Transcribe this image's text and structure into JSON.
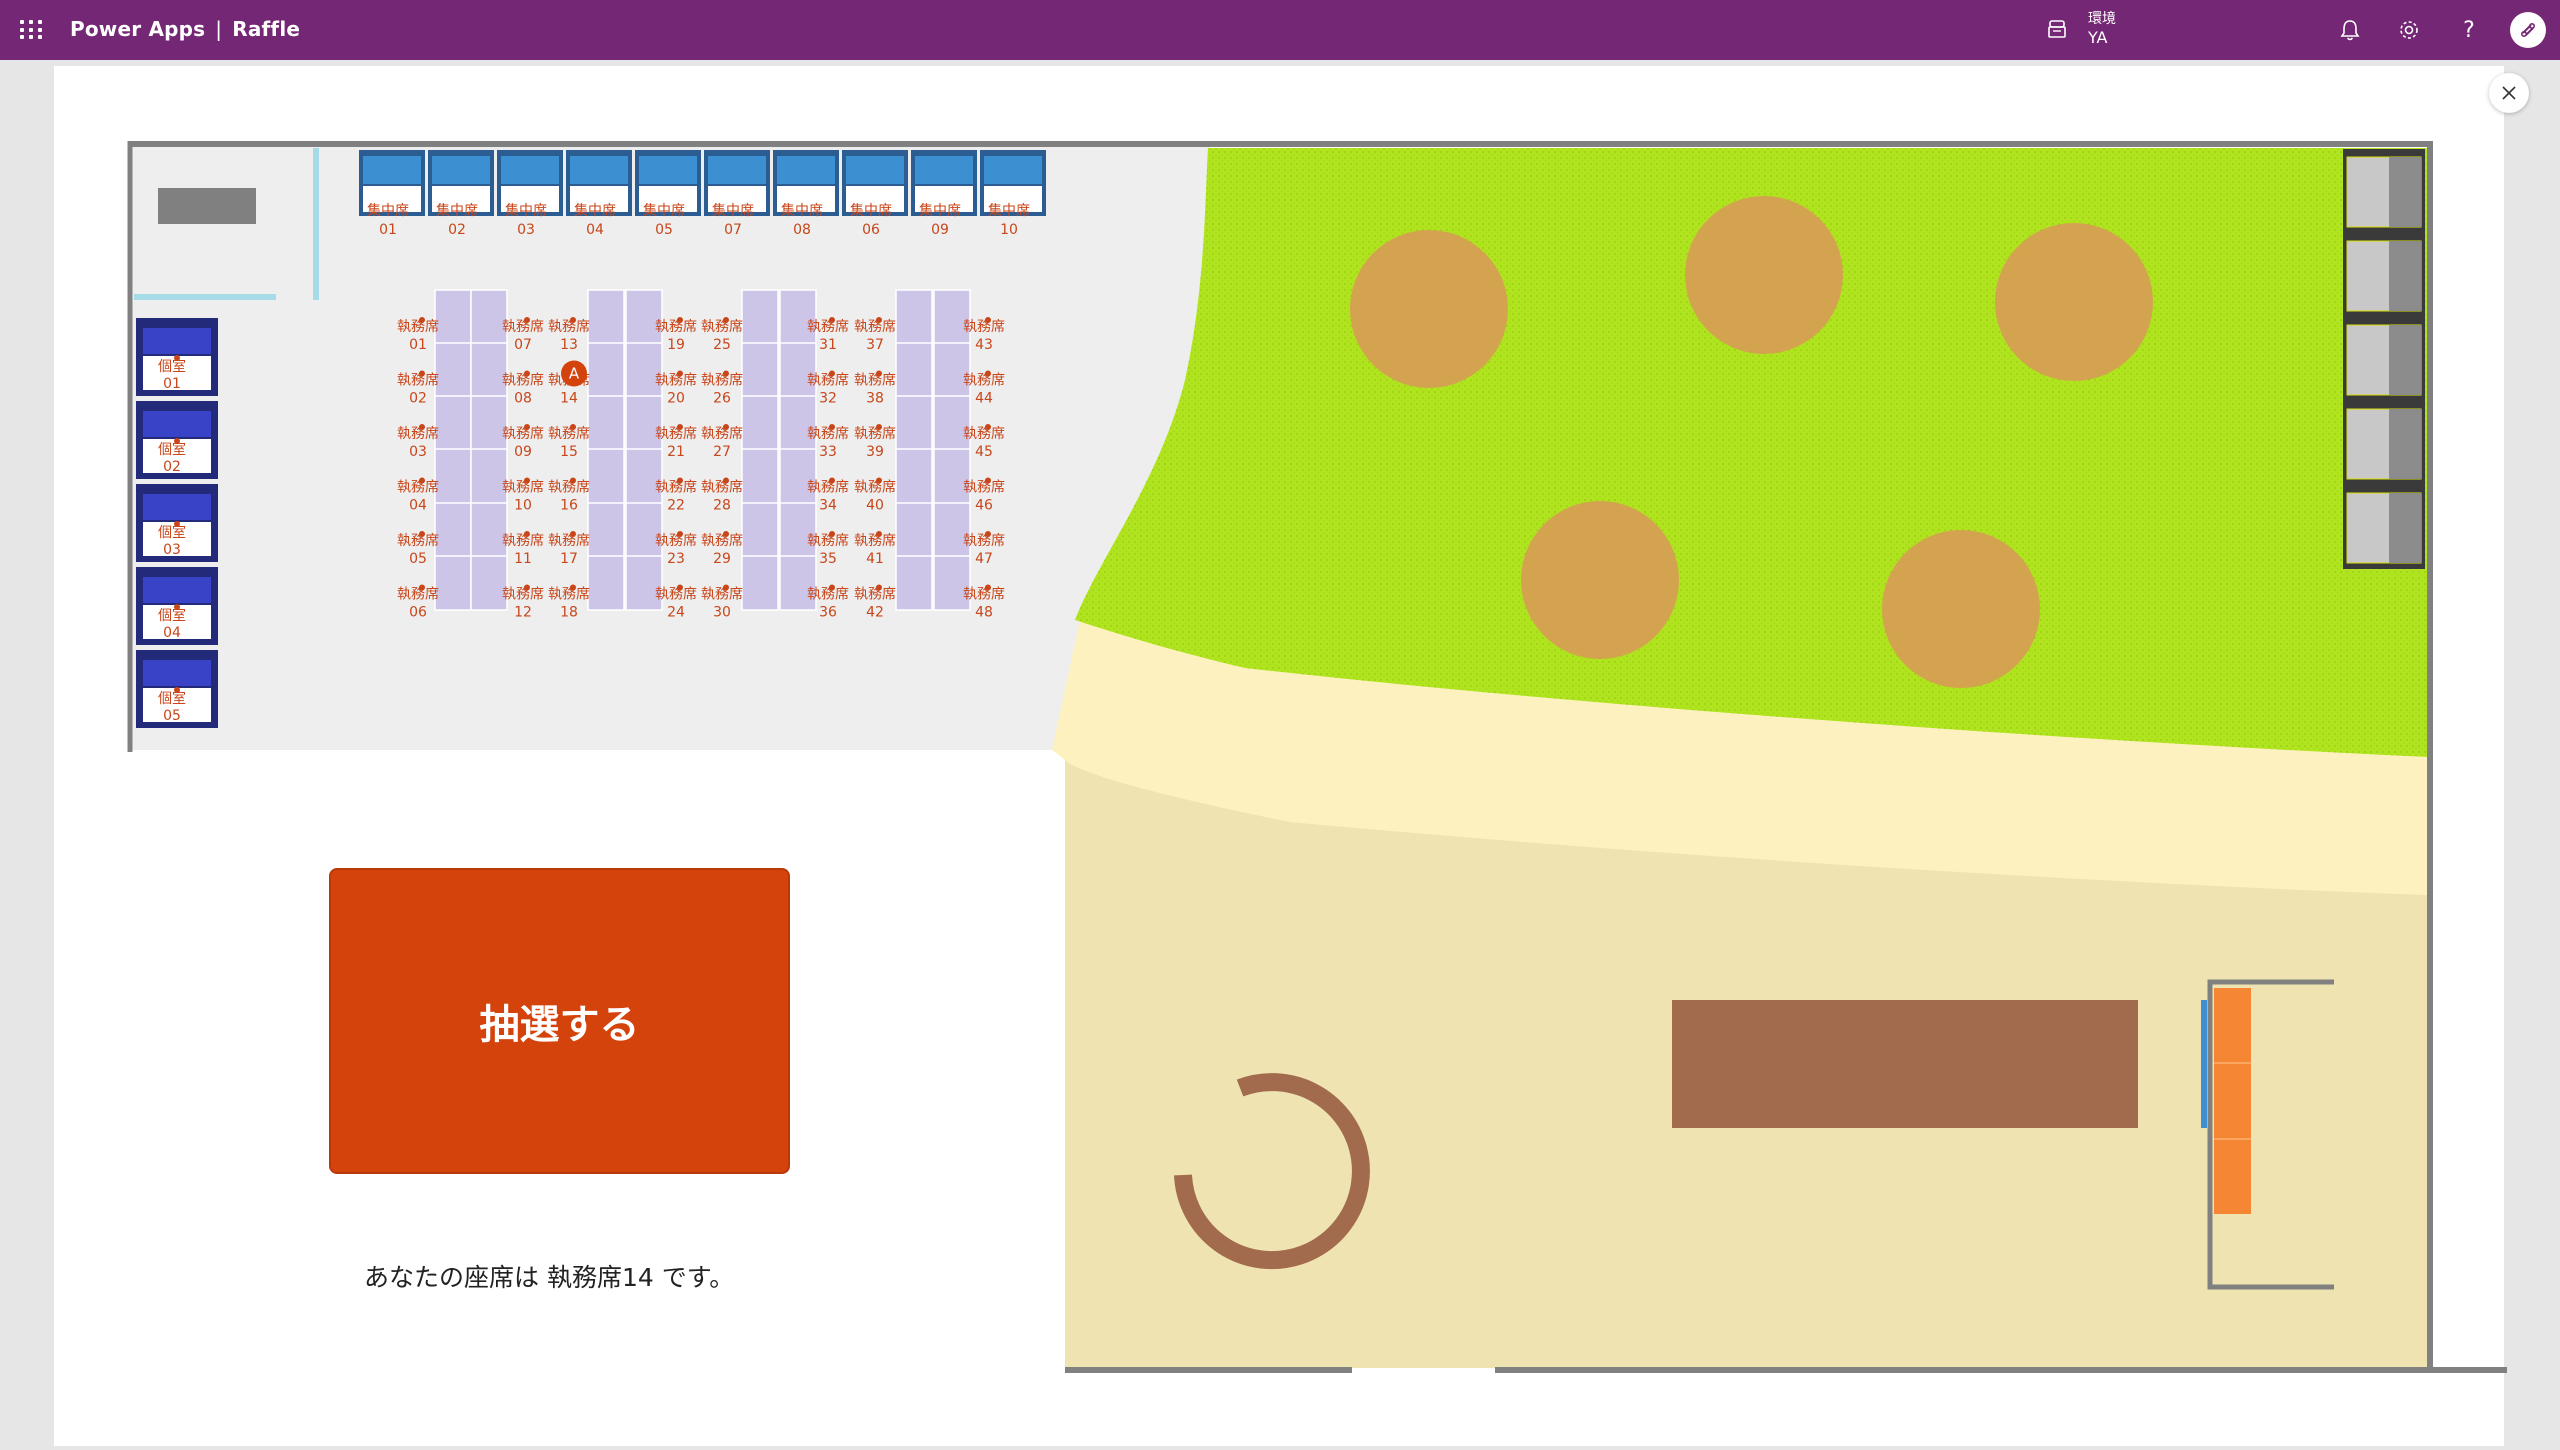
{
  "header": {
    "app_name": "Power Apps",
    "separator": "|",
    "app_title": "Raffle",
    "env_label": "環境",
    "env_name": "YA",
    "icons": [
      "waffle-icon",
      "environment-icon",
      "bell-icon",
      "gear-icon",
      "help-icon",
      "avatar-icon"
    ],
    "help_glyph": "?"
  },
  "floor": {
    "focus_seats": [
      {
        "label": "集中席",
        "num": "01"
      },
      {
        "label": "集中席",
        "num": "02"
      },
      {
        "label": "集中席",
        "num": "03"
      },
      {
        "label": "集中席",
        "num": "04"
      },
      {
        "label": "集中席",
        "num": "05"
      },
      {
        "label": "集中席",
        "num": "07"
      },
      {
        "label": "集中席",
        "num": "08"
      },
      {
        "label": "集中席",
        "num": "06"
      },
      {
        "label": "集中席",
        "num": "09"
      },
      {
        "label": "集中席",
        "num": "10"
      }
    ],
    "private_rooms": [
      {
        "label": "個室",
        "num": "01"
      },
      {
        "label": "個室",
        "num": "02"
      },
      {
        "label": "個室",
        "num": "03"
      },
      {
        "label": "個室",
        "num": "04"
      },
      {
        "label": "個室",
        "num": "05"
      }
    ],
    "desk_label": "執務席",
    "desk_columns": [
      [
        "01",
        "02",
        "03",
        "04",
        "05",
        "06"
      ],
      [
        "07",
        "08",
        "09",
        "10",
        "11",
        "12"
      ],
      [
        "13",
        "14",
        "15",
        "16",
        "17",
        "18"
      ],
      [
        "19",
        "20",
        "21",
        "22",
        "23",
        "24"
      ],
      [
        "25",
        "26",
        "27",
        "28",
        "29",
        "30"
      ],
      [
        "31",
        "32",
        "33",
        "34",
        "35",
        "36"
      ],
      [
        "37",
        "38",
        "39",
        "40",
        "41",
        "42"
      ],
      [
        "43",
        "44",
        "45",
        "46",
        "47",
        "48"
      ]
    ],
    "selected_marker": "A",
    "selected_seat": "14"
  },
  "raffle_button": {
    "label": "抽選する"
  },
  "result_text": "あなたの座席は 執務席14 です。",
  "colors": {
    "header": "#742774",
    "button": "#d4430c",
    "grass": "#b0e41e",
    "sand": "#f0e3b2",
    "path": "#fdf2bf",
    "tree": "#d4a34f",
    "desk": "#ccc5e8",
    "seat_text": "#c8461a",
    "private_room": "#3843c8",
    "focus_seat": "#3c8fd0"
  }
}
